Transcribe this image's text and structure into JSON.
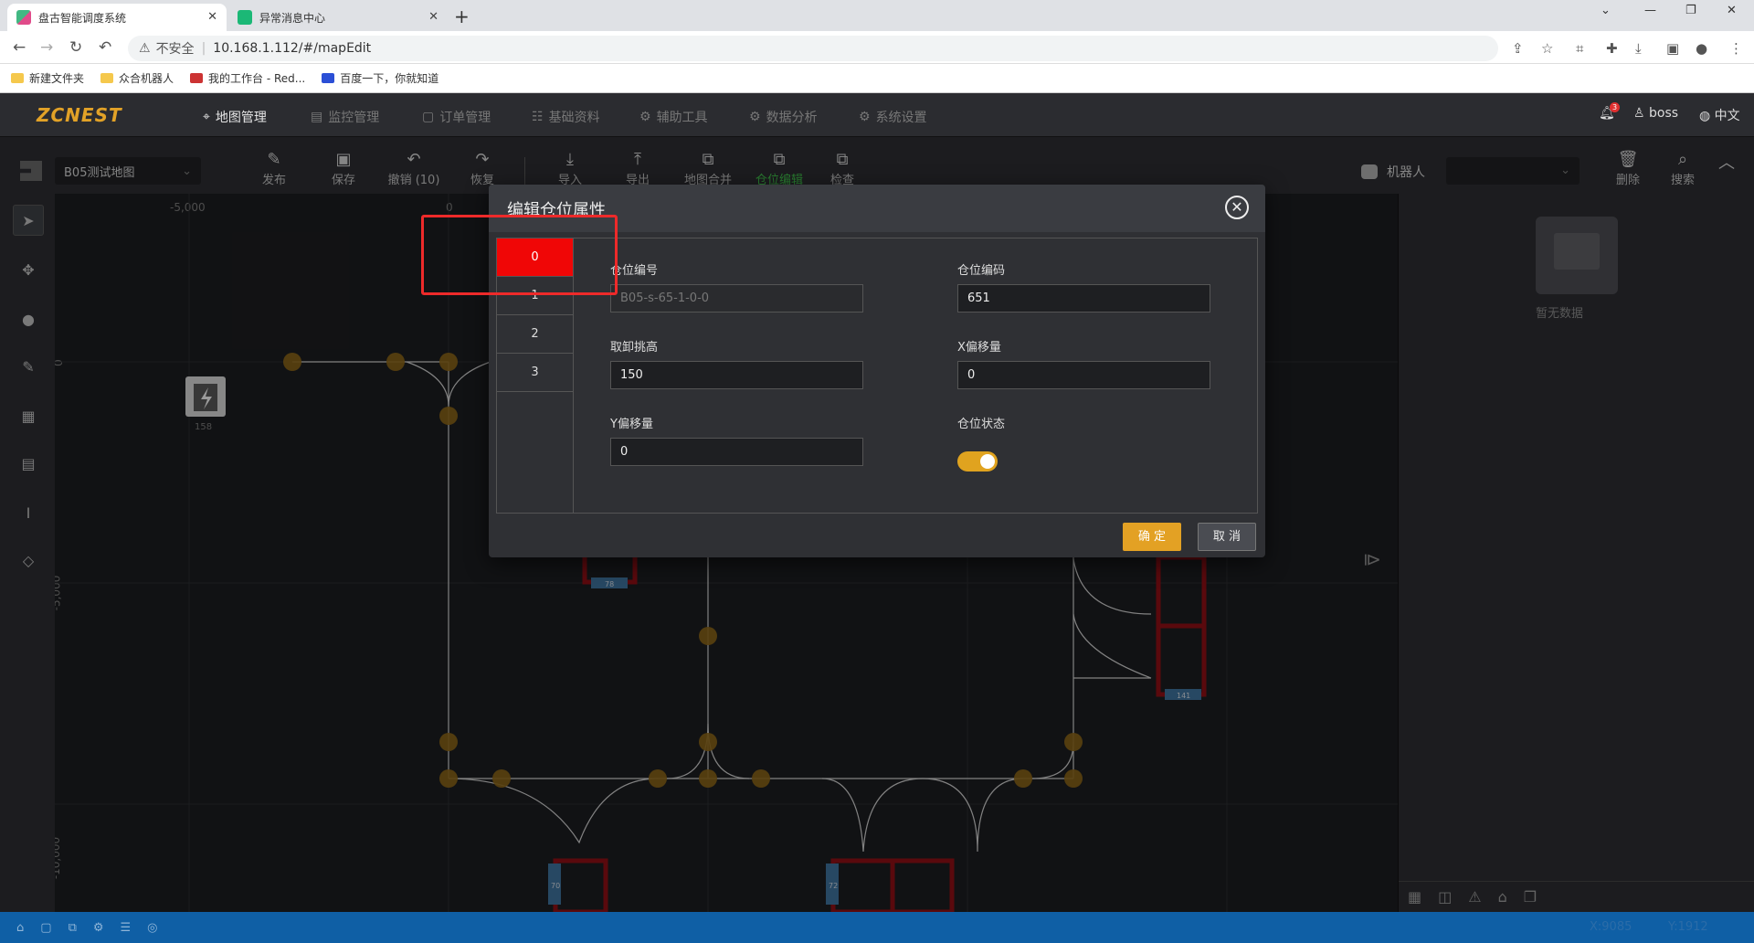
{
  "browser": {
    "tabs": [
      {
        "title": "盘古智能调度系统",
        "icon": "vue-icon"
      },
      {
        "title": "异常消息中心",
        "icon": "play-icon"
      }
    ],
    "address": {
      "security": "不安全",
      "url": "10.168.1.112/#/mapEdit"
    },
    "bookmarks": [
      "新建文件夹",
      "众合机器人",
      "我的工作台 - Red...",
      "百度一下，你就知道"
    ]
  },
  "app": {
    "logo": "ZCNEST",
    "menu": [
      "地图管理",
      "监控管理",
      "订单管理",
      "基础资料",
      "辅助工具",
      "数据分析",
      "系统设置"
    ],
    "notification_count": "3",
    "user": "boss",
    "language": "中文"
  },
  "toolbar": {
    "map_select": "B05测试地图",
    "buttons": [
      "发布",
      "保存",
      "撤销 (10)",
      "恢复",
      "导入",
      "导出",
      "地图合并",
      "仓位编辑",
      "检查"
    ],
    "robot_label": "机器人",
    "right_buttons": [
      "删除",
      "搜索"
    ]
  },
  "canvas": {
    "x_ticks": [
      "-5,000",
      "0"
    ],
    "y_ticks": [
      "0",
      "-5,000",
      "-10,000"
    ],
    "charger_label": "158",
    "shelf_labels": [
      "78",
      "141",
      "70",
      "72"
    ]
  },
  "right_panel": {
    "empty_text": "暂无数据"
  },
  "status": {
    "x": "X:9085",
    "y": "Y:1912"
  },
  "dialog": {
    "title": "编辑仓位属性",
    "indices": [
      "0",
      "1",
      "2",
      "3"
    ],
    "fields": {
      "slot_number_label": "仓位编号",
      "slot_number_value": "B05-s-65-1-0-0",
      "slot_code_label": "仓位编码",
      "slot_code_value": "651",
      "lift_height_label": "取卸挑高",
      "lift_height_value": "150",
      "x_offset_label": "X偏移量",
      "x_offset_value": "0",
      "y_offset_label": "Y偏移量",
      "y_offset_value": "0",
      "status_label": "仓位状态",
      "status_on": true
    },
    "ok": "确 定",
    "cancel": "取 消"
  },
  "colors": {
    "accent": "#e3a124",
    "highlight_red": "#f00606",
    "statusbar": "#0f5fa5"
  }
}
